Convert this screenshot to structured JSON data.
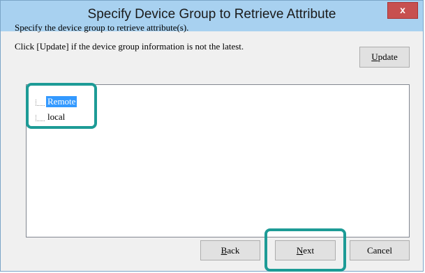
{
  "window": {
    "title": "Specify Device Group to Retrieve Attribute",
    "close_glyph": "x"
  },
  "content": {
    "line1": "Specify the device group to retrieve attribute(s).",
    "line2": "Click [Update] if the device group information is not the latest."
  },
  "buttons": {
    "update_first": "U",
    "update_rest": "pdate",
    "back_first": "B",
    "back_rest": "ack",
    "next_first": "N",
    "next_rest": "ext",
    "cancel": "Cancel"
  },
  "tree": {
    "items": [
      {
        "label": "Remote",
        "selected": true
      },
      {
        "label": "local",
        "selected": false
      }
    ]
  },
  "colors": {
    "titlebar": "#a8d1f0",
    "highlight": "#1d9b96",
    "selection": "#3399ff"
  }
}
